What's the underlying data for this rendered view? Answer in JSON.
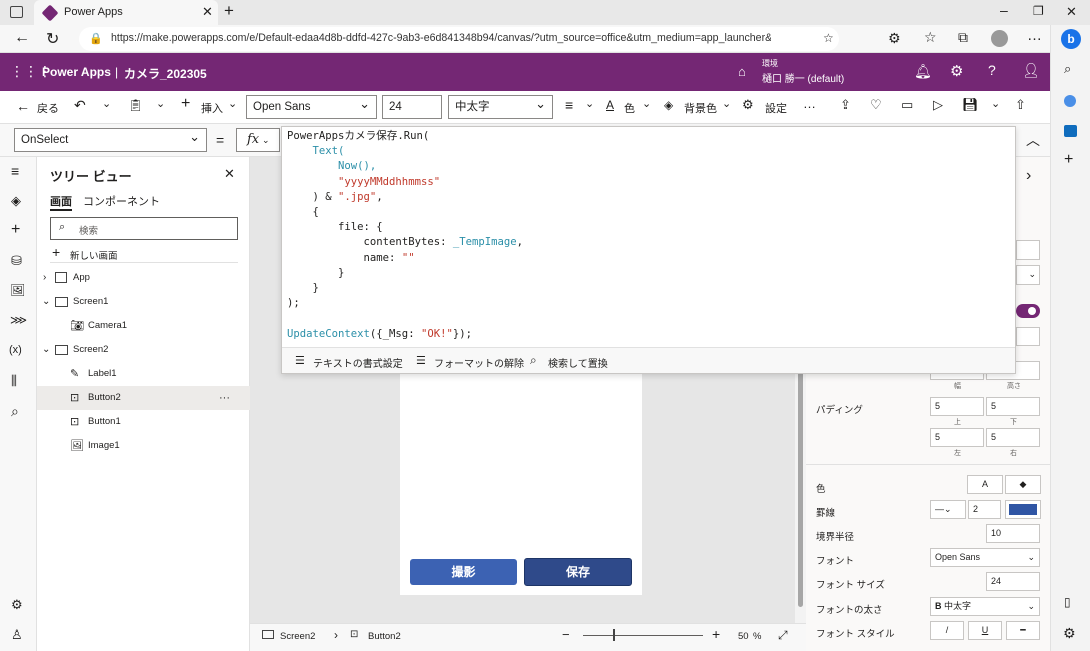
{
  "browser": {
    "tab_title": "Power Apps",
    "url": "https://make.powerapps.com/e/Default-edaa4d8b-ddfd-427c-9ab3-e6d841348b94/canvas/?utm_source=office&utm_medium=app_launcher&utm_..."
  },
  "app": {
    "brand": "Power Apps",
    "separator": "|",
    "app_name": "カメラ_202305",
    "env_label": "環境",
    "env_name": "樋口 勝一 (default)"
  },
  "cmd": {
    "back": "戻る",
    "insert": "挿入",
    "font": "Open Sans",
    "size": "24",
    "weight": "中太字",
    "color": "色",
    "bg": "背景色",
    "settings": "設定",
    "more": "…"
  },
  "formula": {
    "property": "OnSelect",
    "eq": "=",
    "fx": "fx"
  },
  "code": {
    "l1": "PowerAppsカメラ保存",
    "l1b": ".Run(",
    "l2": "Text(",
    "l3": "Now(),",
    "l4": "\"yyyyMMddhhmmss\"",
    "l5a": ") & ",
    "l5b": "\".jpg\"",
    "l5c": ",",
    "l6": "{",
    "l7": "file: {",
    "l8a": "contentBytes: ",
    "l8b": "_TempImage",
    "l8c": ",",
    "l9a": "name: ",
    "l9b": "\"\"",
    "l10": "}",
    "l11": "}",
    "l12": ");",
    "l13a": "UpdateContext",
    "l13b": "({_Msg: ",
    "l13c": "\"OK!\"",
    "l13d": "});"
  },
  "editor_footer": {
    "format": "テキストの書式設定",
    "remove": "フォーマットの解除",
    "find": "検索して置換"
  },
  "tree": {
    "title": "ツリー ビュー",
    "tab_screens": "画面",
    "tab_components": "コンポーネント",
    "search_placeholder": "検索",
    "new_screen": "新しい画面",
    "items": [
      "App",
      "Screen1",
      "Camera1",
      "Screen2",
      "Label1",
      "Button2",
      "Button1",
      "Image1"
    ],
    "dots": "···"
  },
  "canvas": {
    "btn_capture": "撮影",
    "btn_save": "保存"
  },
  "status": {
    "screen": "Screen2",
    "control": "Button2",
    "zoom": "50",
    "pct": "%"
  },
  "props": {
    "w_label": "幅",
    "h_label": "高さ",
    "padding": "パディング",
    "pad_top": "5",
    "pad_bottom": "5",
    "pad_left": "5",
    "pad_right": "5",
    "top": "上",
    "bottom": "下",
    "left": "左",
    "right": "右",
    "color": "色",
    "border": "罫線",
    "border_w": "2",
    "radius": "境界半径",
    "radius_v": "10",
    "font": "フォント",
    "font_v": "Open Sans",
    "fsize": "フォント サイズ",
    "fsize_v": "24",
    "fweight": "フォントの太さ",
    "fweight_v": "中太字",
    "fstyle": "フォント スタイル",
    "A": "A",
    "B": "B",
    "I": "/",
    "U": "U"
  },
  "colors": {
    "purple": "#742774",
    "button": "#3c62b3",
    "button_dark": "#2f4a8a",
    "border_swatch": "#2f55a4"
  }
}
